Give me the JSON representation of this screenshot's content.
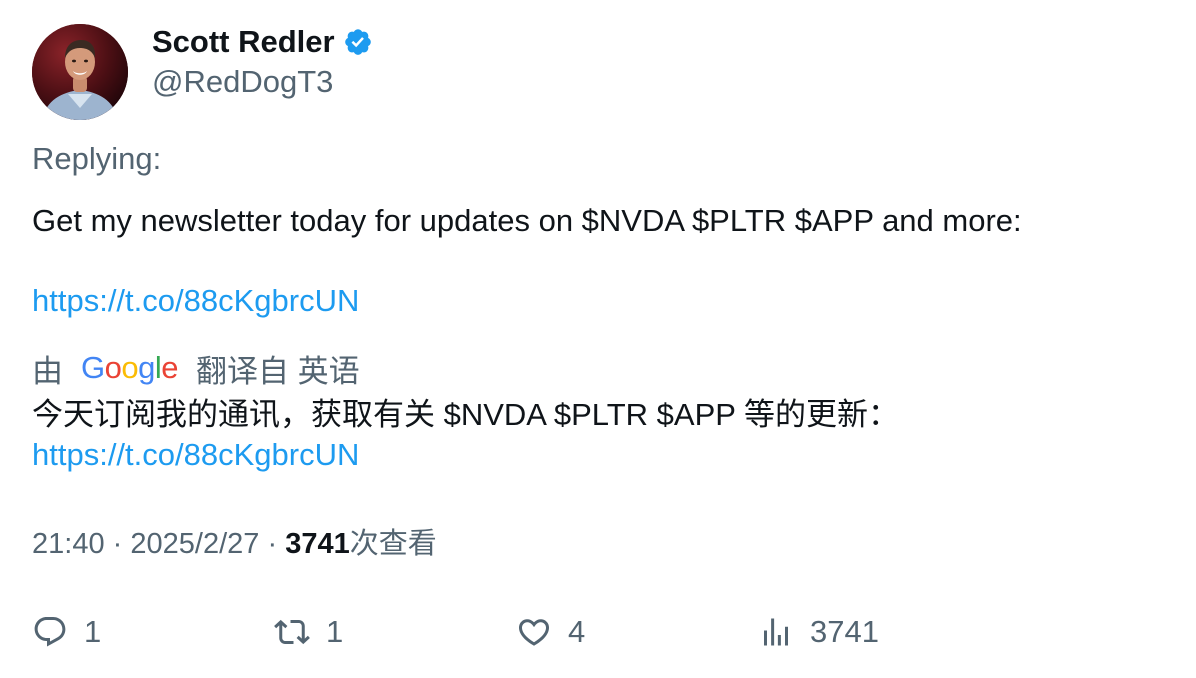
{
  "author": {
    "display_name": "Scott Redler",
    "handle": "@RedDogT3",
    "verified": true
  },
  "replying_label": "Replying:",
  "tweet": {
    "text": "Get my newsletter today for updates on $NVDA $PLTR $APP and more:",
    "link": "https://t.co/88cKgbrcUN"
  },
  "translation": {
    "prefix": "由",
    "provider": "Google",
    "label": "翻译自 英语",
    "text": "今天订阅我的通讯，获取有关 $NVDA $PLTR $APP 等的更新：",
    "link": "https://t.co/88cKgbrcUN"
  },
  "meta": {
    "time": "21:40",
    "separator": "·",
    "date": "2025/2/27",
    "views_count": "3741",
    "views_label": "次查看"
  },
  "actions": {
    "reply_count": "1",
    "retweet_count": "1",
    "like_count": "4",
    "views_count": "3741"
  },
  "colors": {
    "link": "#1d9bf0",
    "secondary_text": "#536471",
    "primary_text": "#0f1419",
    "verified_badge": "#1d9bf0"
  },
  "icons": {
    "verified": "verified-badge-icon",
    "reply": "reply-icon",
    "retweet": "retweet-icon",
    "like": "heart-icon",
    "views": "bar-chart-icon"
  }
}
